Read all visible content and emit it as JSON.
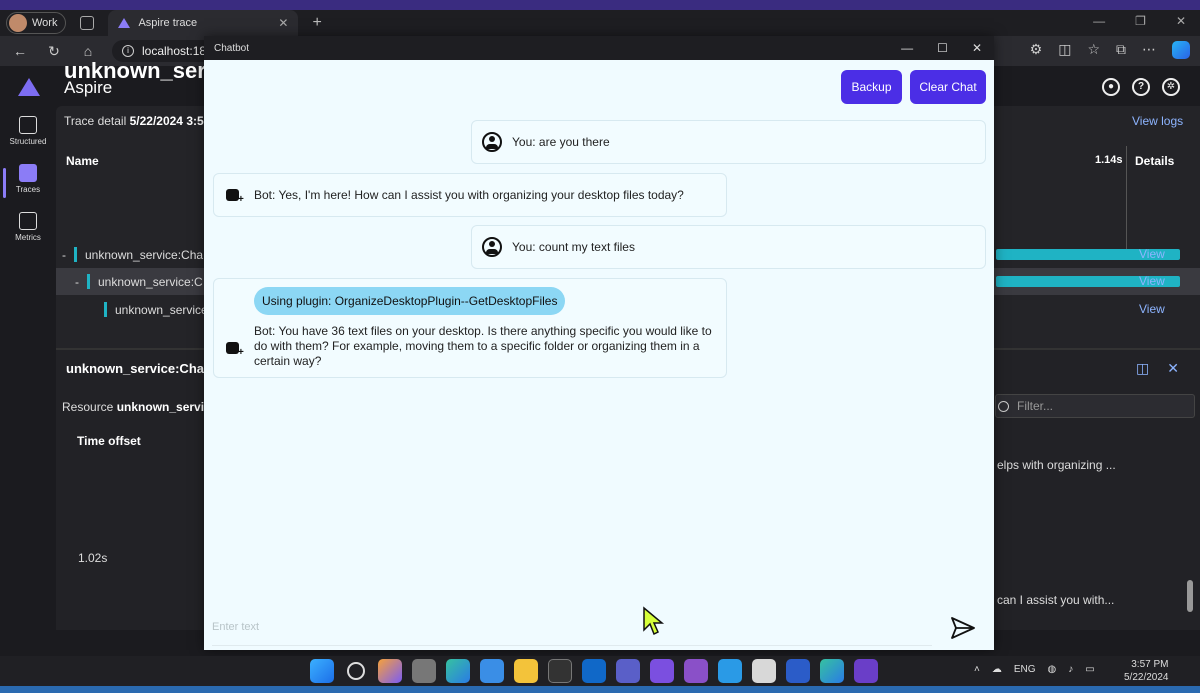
{
  "browser": {
    "profile_label": "Work",
    "tab_title": "Aspire trace",
    "address": "localhost:18"
  },
  "aspire": {
    "app_title": "Aspire",
    "nav": [
      {
        "label": "Structured"
      },
      {
        "label": "Traces"
      },
      {
        "label": "Metrics"
      }
    ],
    "service_title": "unknown_ser",
    "trace_detail_label": "Trace detail",
    "trace_detail_value": "5/22/2024 3:5",
    "view_logs": "View logs",
    "columns": {
      "name": "Name",
      "duration": "1.14s",
      "details": "Details"
    },
    "spans": [
      {
        "prefix": "-",
        "name": "unknown_service:Cha",
        "view": "View"
      },
      {
        "prefix": "-",
        "name": "unknown_service:C",
        "view": "View"
      },
      {
        "prefix": "",
        "name": "unknown_service",
        "view": "View"
      }
    ],
    "detail_title": "unknown_service:Cha",
    "resource_label": "Resource",
    "resource_value": "unknown_servic",
    "filter_placeholder": "Filter...",
    "time_offset": "Time offset",
    "time_value": "1.02s",
    "right_text_1": "elps with organizing ...",
    "right_text_2": "can I assist you with..."
  },
  "chatbot": {
    "window_title": "Chatbot",
    "buttons": {
      "backup": "Backup",
      "clear": "Clear Chat"
    },
    "messages": [
      {
        "role": "user",
        "text": "You: are you there"
      },
      {
        "role": "bot",
        "text": "Bot: Yes, I'm here! How can I assist you with organizing your desktop files today?"
      },
      {
        "role": "user",
        "text": "You: count my text files"
      },
      {
        "role": "bot",
        "plugin": "Using plugin: OrganizeDesktopPlugin--GetDesktopFiles",
        "text": "Bot: You have 36 text files on your desktop. Is there anything specific you would like to do with them? For example, moving them to a specific folder or organizing them in a certain way?"
      }
    ],
    "input_placeholder": "Enter text"
  },
  "taskbar": {
    "language": "ENG",
    "time": "3:57 PM",
    "date": "5/22/2024"
  }
}
